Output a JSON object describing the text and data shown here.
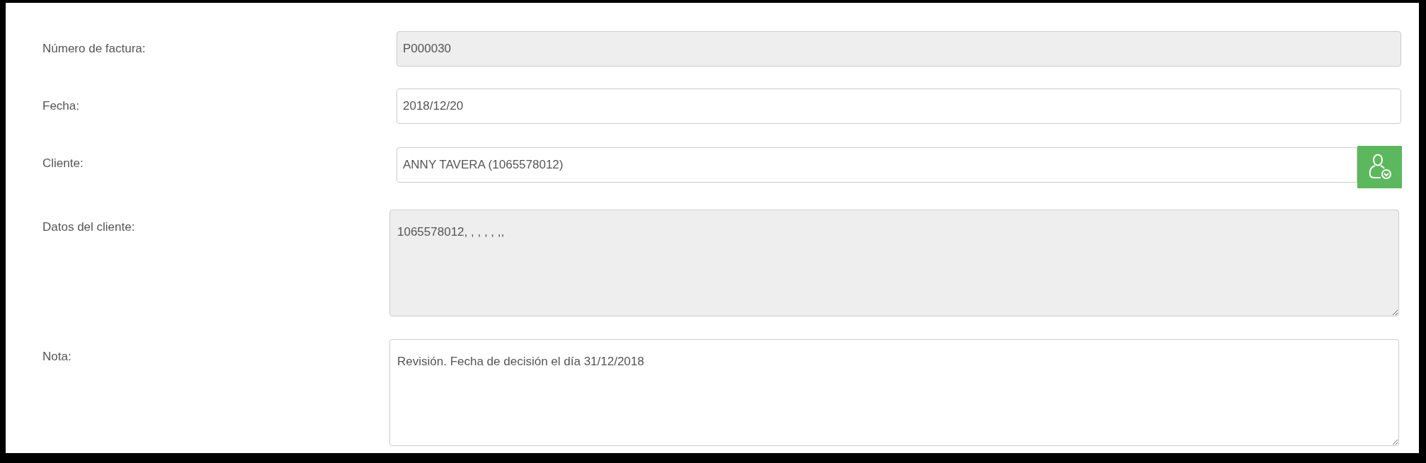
{
  "fields": [
    {
      "label": "Número de factura:",
      "kind": "input",
      "value": "P000030",
      "disabled": true
    },
    {
      "label": "Fecha:",
      "kind": "input",
      "value": "2018/12/20",
      "disabled": false
    },
    {
      "label": "Cliente:",
      "kind": "input_button",
      "value": "ANNY TAVERA (1065578012)",
      "disabled": false
    },
    {
      "label": "Datos del cliente:",
      "kind": "textarea",
      "value": "1065578012, , , , , ,,",
      "disabled": true
    },
    {
      "label": "Nota:",
      "kind": "textarea",
      "value": "Revisión. Fecha de decisión el día 31/12/2018",
      "disabled": false
    }
  ]
}
